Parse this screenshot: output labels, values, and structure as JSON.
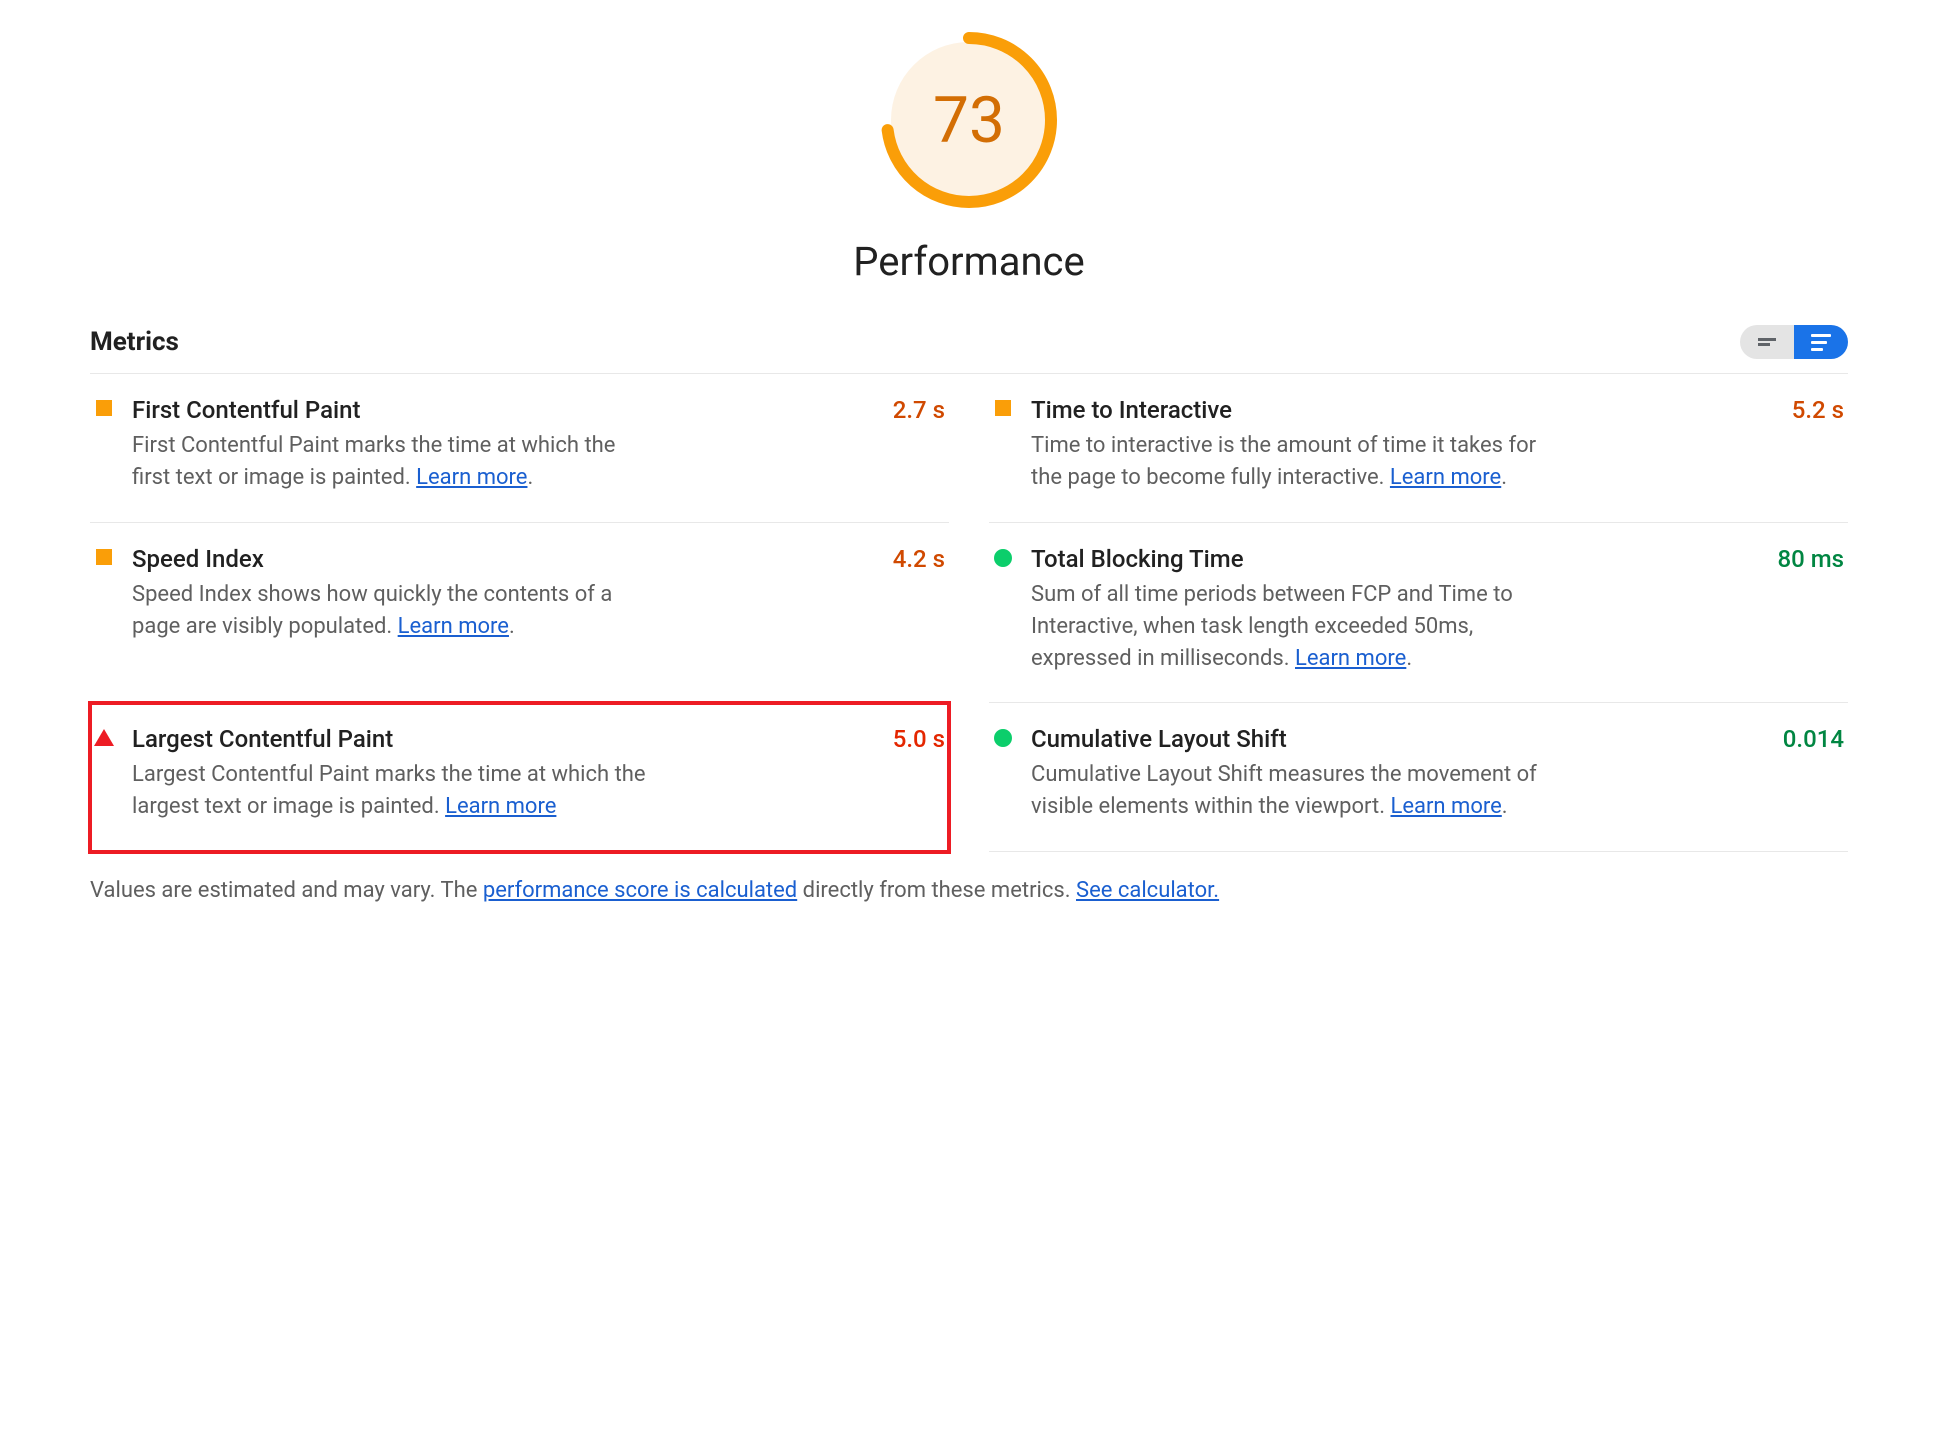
{
  "gauge": {
    "score": "73",
    "percent": 73,
    "title": "Performance",
    "color": "#fa9e08"
  },
  "metrics_label": "Metrics",
  "learn_more": "Learn more",
  "metrics": [
    {
      "name": "First Contentful Paint",
      "value": "2.7 s",
      "status": "average",
      "desc_pre": "First Contentful Paint marks the time at which the first text or image is painted. ",
      "desc_post": "."
    },
    {
      "name": "Time to Interactive",
      "value": "5.2 s",
      "status": "average",
      "desc_pre": "Time to interactive is the amount of time it takes for the page to become fully interactive. ",
      "desc_post": "."
    },
    {
      "name": "Speed Index",
      "value": "4.2 s",
      "status": "average",
      "desc_pre": "Speed Index shows how quickly the contents of a page are visibly populated. ",
      "desc_post": "."
    },
    {
      "name": "Total Blocking Time",
      "value": "80 ms",
      "status": "good",
      "desc_pre": "Sum of all time periods between FCP and Time to Interactive, when task length exceeded 50ms, expressed in milliseconds. ",
      "desc_post": "."
    },
    {
      "name": "Largest Contentful Paint",
      "value": "5.0 s",
      "status": "poor",
      "highlighted": true,
      "desc_pre": "Largest Contentful Paint marks the time at which the largest text or image is painted. ",
      "desc_post": ""
    },
    {
      "name": "Cumulative Layout Shift",
      "value": "0.014",
      "status": "good",
      "desc_pre": "Cumulative Layout Shift measures the movement of visible elements within the viewport. ",
      "desc_post": "."
    }
  ],
  "footer": {
    "pre": "Values are estimated and may vary. The ",
    "link1": "performance score is calculated",
    "mid": " directly from these metrics. ",
    "link2": "See calculator."
  }
}
